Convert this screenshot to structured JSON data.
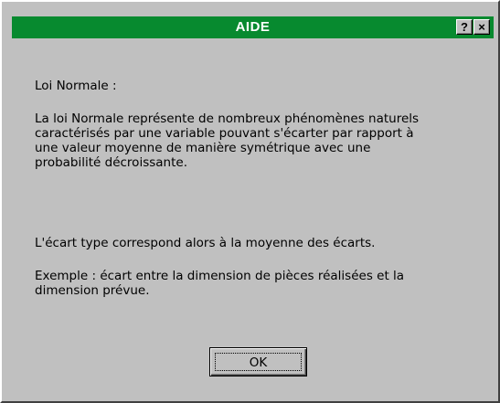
{
  "window": {
    "title": "AIDE",
    "help_label": "?",
    "close_label": "×",
    "title_bar_color": "#078a2f",
    "background_color": "#c0c0c0"
  },
  "content": {
    "heading": "Loi Normale :",
    "description": "La loi Normale représente de nombreux phénomènes naturels\ncaractérisés par une variable pouvant s'écarter par rapport à\nune valeur moyenne de manière symétrique avec une\nprobabilité décroissante.",
    "ecart_type": "L'écart type correspond alors à la moyenne des écarts.",
    "exemple": "Exemple : écart entre la dimension de pièces réalisées et la\ndimension prévue."
  },
  "buttons": {
    "ok_label": "OK"
  }
}
